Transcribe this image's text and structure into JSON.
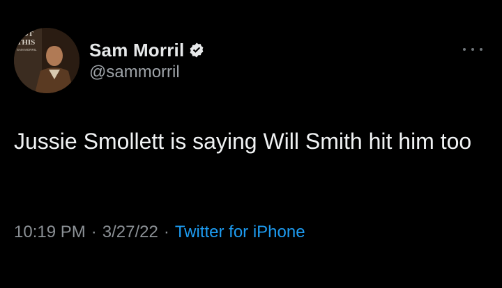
{
  "tweet": {
    "author": {
      "display_name": "Sam Morril",
      "handle": "@sammorril",
      "verified": true,
      "avatar_text": [
        "NOT",
        "THIS",
        "SAM MORRIL"
      ]
    },
    "text": "Jussie Smollett is saying Will Smith hit him too",
    "meta": {
      "time": "10:19 PM",
      "separator": "·",
      "date": "3/27/22",
      "source": "Twitter for iPhone"
    },
    "more_icon": "more-horizontal-icon",
    "colors": {
      "background": "#000000",
      "text": "#e7e9ea",
      "secondary": "#9ea3a8",
      "link": "#1d9bf0",
      "verified_badge": "#e7e9ea"
    }
  }
}
